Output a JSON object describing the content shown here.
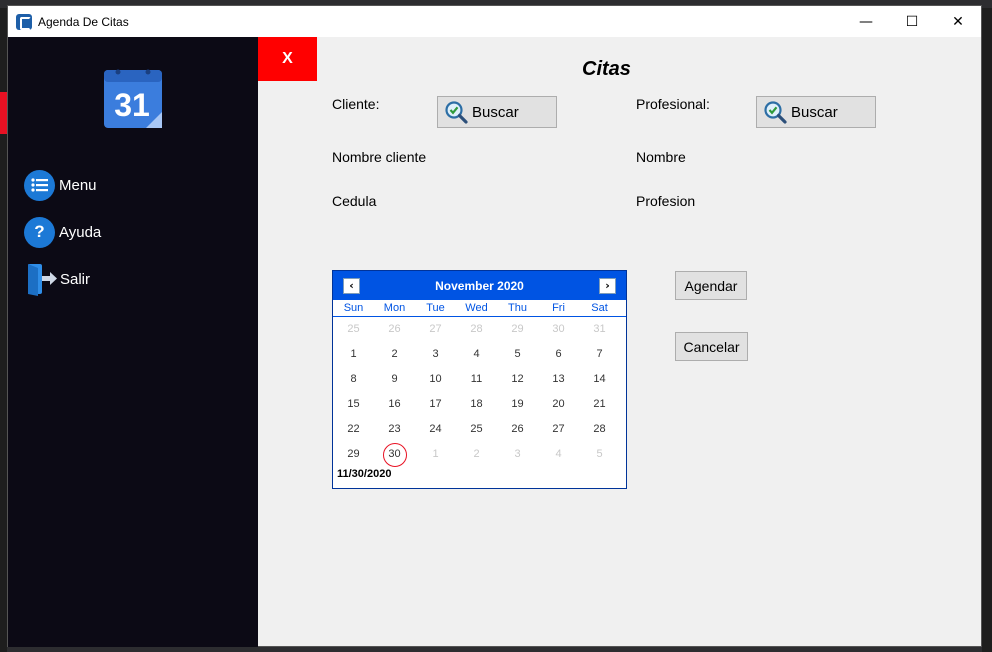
{
  "window": {
    "title": "Agenda De Citas",
    "controls": {
      "minimize": "—",
      "maximize": "☐",
      "close": "✕"
    }
  },
  "sidebar": {
    "logo_number": "31",
    "items": [
      {
        "label": "Menu",
        "icon": "list-icon"
      },
      {
        "label": "Ayuda",
        "icon": "help-icon"
      },
      {
        "label": "Salir",
        "icon": "exit-door-icon"
      }
    ]
  },
  "form": {
    "close_label": "X",
    "title": "Citas",
    "cliente_label": "Cliente:",
    "profesional_label": "Profesional:",
    "buscar_cliente_label": "Buscar",
    "buscar_profesional_label": "Buscar",
    "nombre_cliente_label": "Nombre cliente",
    "nombre_label": "Nombre",
    "cedula_label": "Cedula",
    "profesion_label": "Profesion",
    "agendar_label": "Agendar",
    "cancelar_label": "Cancelar"
  },
  "calendar": {
    "month_title": "November 2020",
    "prev": "‹",
    "next": "›",
    "days_of_week": [
      "Sun",
      "Mon",
      "Tue",
      "Wed",
      "Thu",
      "Fri",
      "Sat"
    ],
    "weeks": [
      [
        "25",
        "26",
        "27",
        "28",
        "29",
        "30",
        "31"
      ],
      [
        "1",
        "2",
        "3",
        "4",
        "5",
        "6",
        "7"
      ],
      [
        "8",
        "9",
        "10",
        "11",
        "12",
        "13",
        "14"
      ],
      [
        "15",
        "16",
        "17",
        "18",
        "19",
        "20",
        "21"
      ],
      [
        "22",
        "23",
        "24",
        "25",
        "26",
        "27",
        "28"
      ],
      [
        "29",
        "30",
        "1",
        "2",
        "3",
        "4",
        "5"
      ]
    ],
    "other_month_flags": [
      [
        true,
        true,
        true,
        true,
        true,
        true,
        true
      ],
      [
        false,
        false,
        false,
        false,
        false,
        false,
        false
      ],
      [
        false,
        false,
        false,
        false,
        false,
        false,
        false
      ],
      [
        false,
        false,
        false,
        false,
        false,
        false,
        false
      ],
      [
        false,
        false,
        false,
        false,
        false,
        false,
        false
      ],
      [
        false,
        false,
        true,
        true,
        true,
        true,
        true
      ]
    ],
    "selected": "30",
    "today_text": "11/30/2020"
  },
  "colors": {
    "sidebar_bg": "#0c0a15",
    "accent_blue": "#0054e3",
    "close_red": "#ff0000"
  }
}
